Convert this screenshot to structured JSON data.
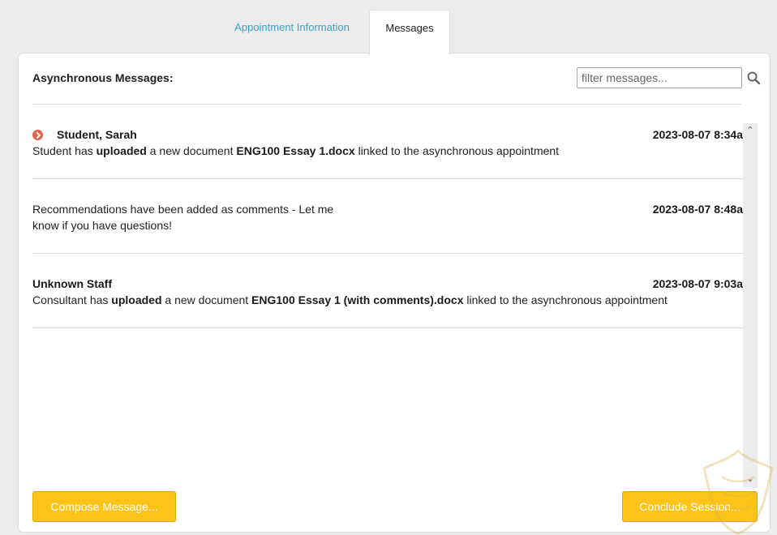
{
  "tabs": [
    {
      "label": "Appointment Information",
      "active": false
    },
    {
      "label": "Messages",
      "active": true
    }
  ],
  "panel": {
    "title": "Asynchronous Messages:",
    "filter_placeholder": "filter messages..."
  },
  "messages": [
    {
      "sender": "Student, Sarah",
      "timestamp": "2023-08-07 8:34a",
      "unread": true,
      "body": {
        "t1": "Student has ",
        "b1": "uploaded",
        "t2": " a new document ",
        "b2": "ENG100 Essay 1.docx",
        "t3": " linked to the asynchronous appointment"
      }
    },
    {
      "sender": "",
      "timestamp": "2023-08-07 8:48a",
      "unread": false,
      "body": {
        "line1": "Recommendations have been added as comments - Let me",
        "line2": "know if you have questions!"
      }
    },
    {
      "sender": "Unknown Staff",
      "timestamp": "2023-08-07 9:03a",
      "unread": false,
      "body": {
        "t1": "Consultant has ",
        "b1": "uploaded",
        "t2": " a new document ",
        "b2": "ENG100 Essay 1 (with comments).docx",
        "t3": " linked to the asynchronous appointment"
      }
    }
  ],
  "buttons": {
    "compose": "Compose Message...",
    "conclude": "Conclude Session..."
  },
  "colors": {
    "tab_link": "#3aa0c8",
    "button_bg": "#fcc419",
    "unread_badge": "#e2624a"
  },
  "icons": {
    "search": "search-icon",
    "unread": "chevron-right-circle-icon",
    "scroll_up": "chevron-up-icon",
    "scroll_down": "chevron-down-icon"
  }
}
